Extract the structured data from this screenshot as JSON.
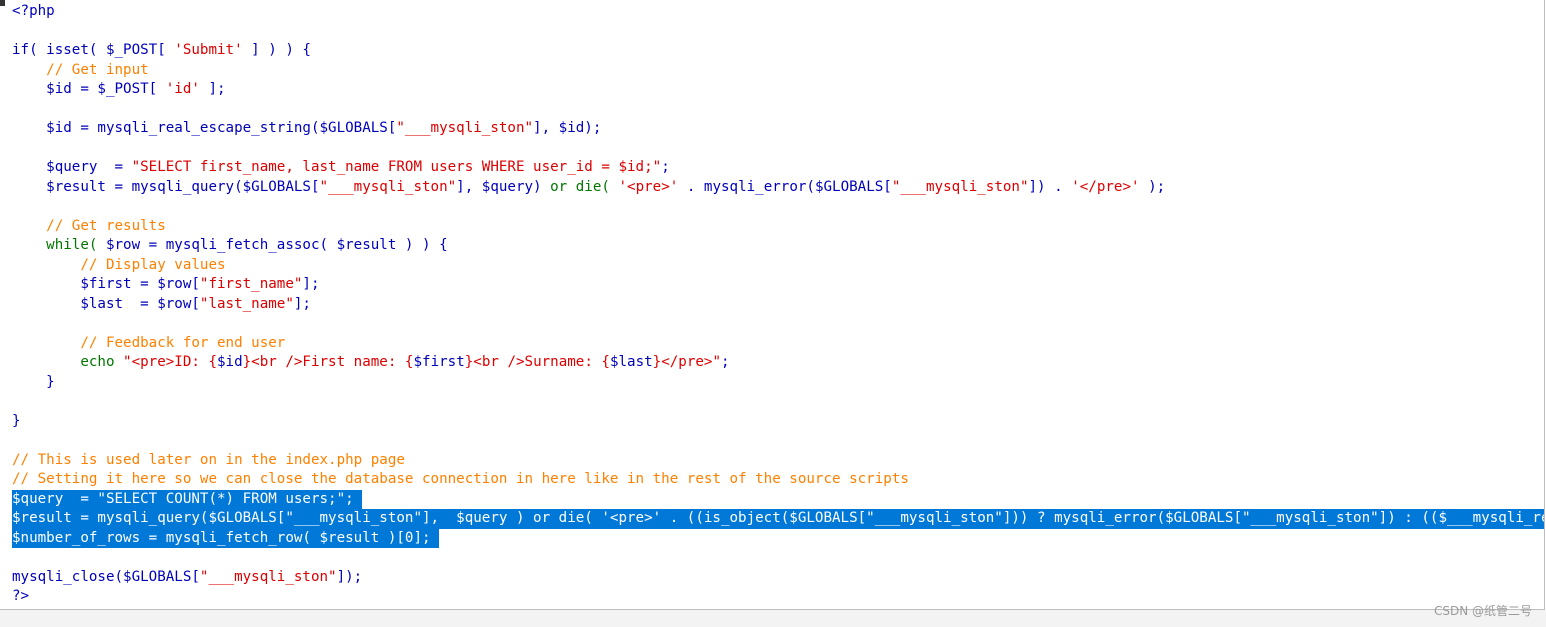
{
  "watermark": "CSDN @纸管二号",
  "code_lines": [
    {
      "tokens": [
        {
          "t": "<?php",
          "c": "code"
        }
      ]
    },
    {
      "tokens": []
    },
    {
      "tokens": [
        {
          "t": "if( isset( $_POST[ ",
          "c": "code"
        },
        {
          "t": "'Submit'",
          "c": "str"
        },
        {
          "t": " ] ) ) {",
          "c": "code"
        }
      ]
    },
    {
      "tokens": [
        {
          "t": "    // Get input",
          "c": "com"
        }
      ]
    },
    {
      "tokens": [
        {
          "t": "    $id = $_POST[ ",
          "c": "code"
        },
        {
          "t": "'id'",
          "c": "str"
        },
        {
          "t": " ];",
          "c": "code"
        }
      ]
    },
    {
      "tokens": []
    },
    {
      "tokens": [
        {
          "t": "    $id = mysqli_real_escape_string($GLOBALS[",
          "c": "code"
        },
        {
          "t": "\"___mysqli_ston\"",
          "c": "str"
        },
        {
          "t": "], $id);",
          "c": "code"
        }
      ]
    },
    {
      "tokens": []
    },
    {
      "tokens": [
        {
          "t": "    $query  = ",
          "c": "code"
        },
        {
          "t": "\"SELECT first_name, last_name FROM users WHERE user_id = $id;\"",
          "c": "str"
        },
        {
          "t": ";",
          "c": "code"
        }
      ]
    },
    {
      "tokens": [
        {
          "t": "    $result = mysqli_query($GLOBALS[",
          "c": "code"
        },
        {
          "t": "\"___mysqli_ston\"",
          "c": "str"
        },
        {
          "t": "], $query) ",
          "c": "code"
        },
        {
          "t": "or die(",
          "c": "kw"
        },
        {
          "t": " ",
          "c": "code"
        },
        {
          "t": "'<pre>'",
          "c": "str"
        },
        {
          "t": " . mysqli_error($GLOBALS[",
          "c": "code"
        },
        {
          "t": "\"___mysqli_ston\"",
          "c": "str"
        },
        {
          "t": "]) . ",
          "c": "code"
        },
        {
          "t": "'</pre>'",
          "c": "str"
        },
        {
          "t": " );",
          "c": "code"
        }
      ]
    },
    {
      "tokens": []
    },
    {
      "tokens": [
        {
          "t": "    // Get results",
          "c": "com"
        }
      ]
    },
    {
      "tokens": [
        {
          "t": "    while( ",
          "c": "kw"
        },
        {
          "t": "$row = mysqli_fetch_assoc( $result ) ) {",
          "c": "code"
        }
      ]
    },
    {
      "tokens": [
        {
          "t": "        // Display values",
          "c": "com"
        }
      ]
    },
    {
      "tokens": [
        {
          "t": "        $first = $row[",
          "c": "code"
        },
        {
          "t": "\"first_name\"",
          "c": "str"
        },
        {
          "t": "];",
          "c": "code"
        }
      ]
    },
    {
      "tokens": [
        {
          "t": "        $last  = $row[",
          "c": "code"
        },
        {
          "t": "\"last_name\"",
          "c": "str"
        },
        {
          "t": "];",
          "c": "code"
        }
      ]
    },
    {
      "tokens": []
    },
    {
      "tokens": [
        {
          "t": "        // Feedback for end user",
          "c": "com"
        }
      ]
    },
    {
      "tokens": [
        {
          "t": "        echo ",
          "c": "kw"
        },
        {
          "t": "\"<pre>ID: {",
          "c": "str"
        },
        {
          "t": "$id",
          "c": "code"
        },
        {
          "t": "}<br />First name: {",
          "c": "str"
        },
        {
          "t": "$first",
          "c": "code"
        },
        {
          "t": "}<br />Surname: {",
          "c": "str"
        },
        {
          "t": "$last",
          "c": "code"
        },
        {
          "t": "}</pre>\"",
          "c": "str"
        },
        {
          "t": ";",
          "c": "code"
        }
      ]
    },
    {
      "tokens": [
        {
          "t": "    }",
          "c": "code"
        }
      ]
    },
    {
      "tokens": []
    },
    {
      "tokens": [
        {
          "t": "}",
          "c": "code"
        }
      ]
    },
    {
      "tokens": []
    },
    {
      "tokens": [
        {
          "t": "// This is used later on in the index.php page",
          "c": "com"
        }
      ]
    },
    {
      "tokens": [
        {
          "t": "// Setting it here so we can close the database connection in here like in the rest of the source scripts",
          "c": "com"
        }
      ]
    },
    {
      "sel": true,
      "tokens": [
        {
          "t": "$query  = \"SELECT COUNT(*) FROM users;\"; ",
          "c": "code"
        }
      ]
    },
    {
      "sel": true,
      "tokens": [
        {
          "t": "$result = mysqli_query($GLOBALS[\"___mysqli_ston\"],  $query ) or die( '<pre>' . ((is_object($GLOBALS[\"___mysqli_ston\"])) ? mysqli_error($GLOBALS[\"___mysqli_ston\"]) : (($___mysqli_res",
          "c": "code"
        }
      ]
    },
    {
      "sel": true,
      "tokens": [
        {
          "t": "$number_of_rows = mysqli_fetch_row( $result )[0]; ",
          "c": "code"
        }
      ]
    },
    {
      "tokens": []
    },
    {
      "tokens": [
        {
          "t": "mysqli_close($GLOBALS[",
          "c": "code"
        },
        {
          "t": "\"___mysqli_ston\"",
          "c": "str"
        },
        {
          "t": "]);",
          "c": "code"
        }
      ]
    },
    {
      "tokens": [
        {
          "t": "?>",
          "c": "code"
        }
      ]
    }
  ]
}
